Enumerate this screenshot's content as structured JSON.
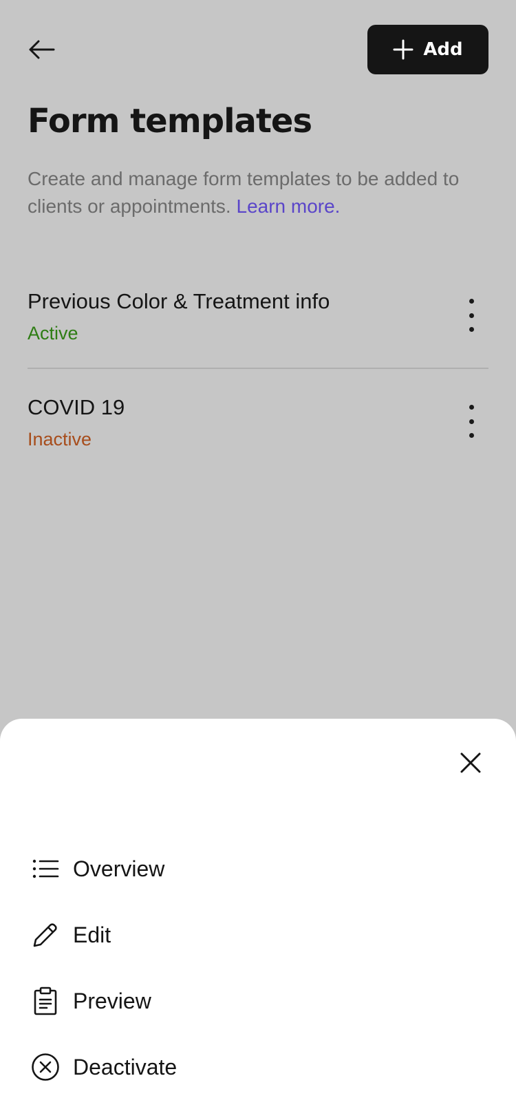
{
  "header": {
    "back_icon": "arrow-left-icon",
    "add_label": "Add",
    "add_icon": "plus-icon"
  },
  "page": {
    "title": "Form templates",
    "description": "Create and manage form templates to be added to clients or appointments.",
    "learn_more": "Learn more."
  },
  "templates": [
    {
      "name": "Previous Color & Treatment info",
      "status": "Active",
      "status_color": "#2e7d14"
    },
    {
      "name": "COVID 19",
      "status": "Inactive",
      "status_color": "#a74d1c"
    }
  ],
  "sheet": {
    "close_icon": "close-icon",
    "menu": [
      {
        "label": "Overview",
        "icon": "list-icon"
      },
      {
        "label": "Edit",
        "icon": "pencil-icon"
      },
      {
        "label": "Preview",
        "icon": "clipboard-icon"
      },
      {
        "label": "Deactivate",
        "icon": "x-circle-icon"
      }
    ]
  },
  "colors": {
    "overlay_background": "#c6c6c6",
    "primary_button": "#151515",
    "link": "#5a45c9"
  }
}
